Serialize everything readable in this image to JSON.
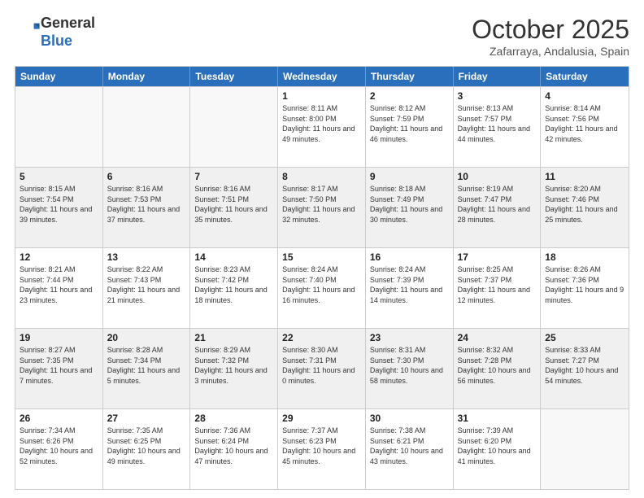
{
  "header": {
    "logo_general": "General",
    "logo_blue": "Blue",
    "month_title": "October 2025",
    "subtitle": "Zafarraya, Andalusia, Spain"
  },
  "days_of_week": [
    "Sunday",
    "Monday",
    "Tuesday",
    "Wednesday",
    "Thursday",
    "Friday",
    "Saturday"
  ],
  "weeks": [
    [
      {
        "day": "",
        "empty": true
      },
      {
        "day": "",
        "empty": true
      },
      {
        "day": "",
        "empty": true
      },
      {
        "day": "1",
        "sunrise": "8:11 AM",
        "sunset": "8:00 PM",
        "daylight": "11 hours and 49 minutes."
      },
      {
        "day": "2",
        "sunrise": "8:12 AM",
        "sunset": "7:59 PM",
        "daylight": "11 hours and 46 minutes."
      },
      {
        "day": "3",
        "sunrise": "8:13 AM",
        "sunset": "7:57 PM",
        "daylight": "11 hours and 44 minutes."
      },
      {
        "day": "4",
        "sunrise": "8:14 AM",
        "sunset": "7:56 PM",
        "daylight": "11 hours and 42 minutes."
      }
    ],
    [
      {
        "day": "5",
        "sunrise": "8:15 AM",
        "sunset": "7:54 PM",
        "daylight": "11 hours and 39 minutes."
      },
      {
        "day": "6",
        "sunrise": "8:16 AM",
        "sunset": "7:53 PM",
        "daylight": "11 hours and 37 minutes."
      },
      {
        "day": "7",
        "sunrise": "8:16 AM",
        "sunset": "7:51 PM",
        "daylight": "11 hours and 35 minutes."
      },
      {
        "day": "8",
        "sunrise": "8:17 AM",
        "sunset": "7:50 PM",
        "daylight": "11 hours and 32 minutes."
      },
      {
        "day": "9",
        "sunrise": "8:18 AM",
        "sunset": "7:49 PM",
        "daylight": "11 hours and 30 minutes."
      },
      {
        "day": "10",
        "sunrise": "8:19 AM",
        "sunset": "7:47 PM",
        "daylight": "11 hours and 28 minutes."
      },
      {
        "day": "11",
        "sunrise": "8:20 AM",
        "sunset": "7:46 PM",
        "daylight": "11 hours and 25 minutes."
      }
    ],
    [
      {
        "day": "12",
        "sunrise": "8:21 AM",
        "sunset": "7:44 PM",
        "daylight": "11 hours and 23 minutes."
      },
      {
        "day": "13",
        "sunrise": "8:22 AM",
        "sunset": "7:43 PM",
        "daylight": "11 hours and 21 minutes."
      },
      {
        "day": "14",
        "sunrise": "8:23 AM",
        "sunset": "7:42 PM",
        "daylight": "11 hours and 18 minutes."
      },
      {
        "day": "15",
        "sunrise": "8:24 AM",
        "sunset": "7:40 PM",
        "daylight": "11 hours and 16 minutes."
      },
      {
        "day": "16",
        "sunrise": "8:24 AM",
        "sunset": "7:39 PM",
        "daylight": "11 hours and 14 minutes."
      },
      {
        "day": "17",
        "sunrise": "8:25 AM",
        "sunset": "7:37 PM",
        "daylight": "11 hours and 12 minutes."
      },
      {
        "day": "18",
        "sunrise": "8:26 AM",
        "sunset": "7:36 PM",
        "daylight": "11 hours and 9 minutes."
      }
    ],
    [
      {
        "day": "19",
        "sunrise": "8:27 AM",
        "sunset": "7:35 PM",
        "daylight": "11 hours and 7 minutes."
      },
      {
        "day": "20",
        "sunrise": "8:28 AM",
        "sunset": "7:34 PM",
        "daylight": "11 hours and 5 minutes."
      },
      {
        "day": "21",
        "sunrise": "8:29 AM",
        "sunset": "7:32 PM",
        "daylight": "11 hours and 3 minutes."
      },
      {
        "day": "22",
        "sunrise": "8:30 AM",
        "sunset": "7:31 PM",
        "daylight": "11 hours and 0 minutes."
      },
      {
        "day": "23",
        "sunrise": "8:31 AM",
        "sunset": "7:30 PM",
        "daylight": "10 hours and 58 minutes."
      },
      {
        "day": "24",
        "sunrise": "8:32 AM",
        "sunset": "7:28 PM",
        "daylight": "10 hours and 56 minutes."
      },
      {
        "day": "25",
        "sunrise": "8:33 AM",
        "sunset": "7:27 PM",
        "daylight": "10 hours and 54 minutes."
      }
    ],
    [
      {
        "day": "26",
        "sunrise": "7:34 AM",
        "sunset": "6:26 PM",
        "daylight": "10 hours and 52 minutes."
      },
      {
        "day": "27",
        "sunrise": "7:35 AM",
        "sunset": "6:25 PM",
        "daylight": "10 hours and 49 minutes."
      },
      {
        "day": "28",
        "sunrise": "7:36 AM",
        "sunset": "6:24 PM",
        "daylight": "10 hours and 47 minutes."
      },
      {
        "day": "29",
        "sunrise": "7:37 AM",
        "sunset": "6:23 PM",
        "daylight": "10 hours and 45 minutes."
      },
      {
        "day": "30",
        "sunrise": "7:38 AM",
        "sunset": "6:21 PM",
        "daylight": "10 hours and 43 minutes."
      },
      {
        "day": "31",
        "sunrise": "7:39 AM",
        "sunset": "6:20 PM",
        "daylight": "10 hours and 41 minutes."
      },
      {
        "day": "",
        "empty": true
      }
    ]
  ]
}
